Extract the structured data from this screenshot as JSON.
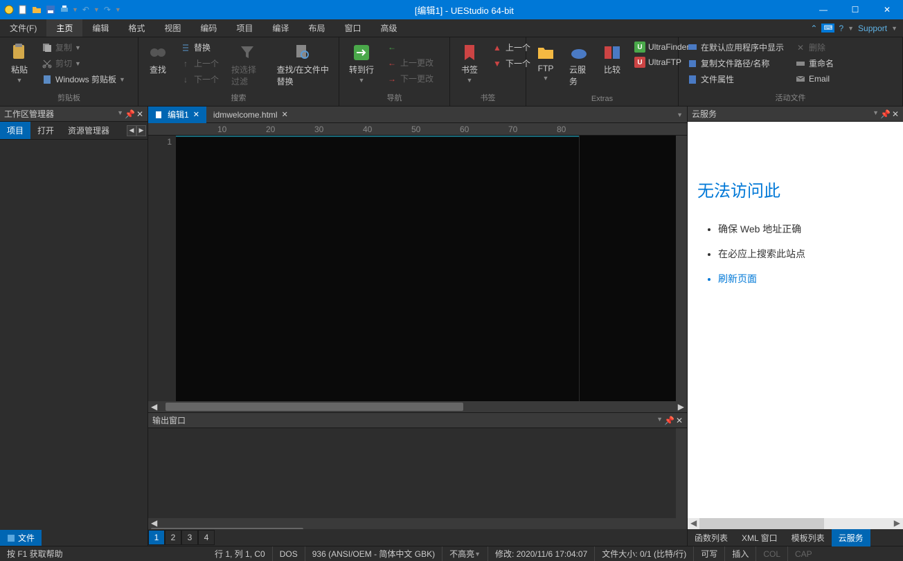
{
  "title": "[编辑1] - UEStudio 64-bit",
  "menu": {
    "file": "文件(F)",
    "items": [
      "主页",
      "编辑",
      "格式",
      "视图",
      "编码",
      "项目",
      "编译",
      "布局",
      "窗口",
      "高级"
    ],
    "support": "Support"
  },
  "ribbon": {
    "clipboard": {
      "paste": "粘贴",
      "copy": "复制",
      "cut": "剪切",
      "windows_clipboard": "Windows 剪贴板",
      "label": "剪贴板"
    },
    "search": {
      "find": "查找",
      "replace": "替换",
      "prev": "上一个",
      "next": "下一个",
      "filter": "按选择过滤",
      "find_in_files": "查找/在文件中替换",
      "label": "搜索"
    },
    "nav": {
      "goto": "转到行",
      "back": "上一更改",
      "forward": "下一更改",
      "label": "导航"
    },
    "bookmark": {
      "bookmark": "书签",
      "prev": "上一个",
      "next": "下一个",
      "label": "书签"
    },
    "extras": {
      "ftp": "FTP",
      "cloud": "云服务",
      "compare": "比较",
      "ultrafinder": "UltraFinder",
      "ultraftp": "UltraFTP",
      "label": "Extras"
    },
    "activefile": {
      "default_prog": "在默认应用程序中显示",
      "delete": "删除",
      "copy_path": "复制文件路径/名称",
      "rename": "重命名",
      "properties": "文件属性",
      "email": "Email",
      "label": "活动文件"
    }
  },
  "left_panel": {
    "title": "工作区管理器",
    "tabs": {
      "project": "项目",
      "open": "打开",
      "explorer": "资源管理器"
    },
    "file_tab": "文件"
  },
  "editor": {
    "tabs": [
      {
        "label": "编辑1",
        "active": true
      },
      {
        "label": "idmwelcome.html",
        "active": false
      }
    ],
    "line_no": "1"
  },
  "output": {
    "title": "输出窗口",
    "tabs": [
      "1",
      "2",
      "3",
      "4"
    ]
  },
  "right_panel": {
    "title": "云服务",
    "error_title": "无法访问此",
    "items": [
      "确保 Web 地址正确",
      "在必应上搜索此站点",
      "刷新页面"
    ],
    "tabs": [
      "函数列表",
      "XML 窗口",
      "模板列表",
      "云服务"
    ]
  },
  "status": {
    "help": "按 F1 获取帮助",
    "pos": "行 1, 列 1, C0",
    "format": "DOS",
    "encoding": "936  (ANSI/OEM - 简体中文 GBK)",
    "highlight": "不高亮",
    "modified": "修改:",
    "datetime": "2020/11/6 17:04:07",
    "filesize": "文件大小:",
    "bytes": "0/1  (比特/行)",
    "readwrite": "可写",
    "insert": "插入",
    "col": "COL",
    "cap": "CAP"
  }
}
